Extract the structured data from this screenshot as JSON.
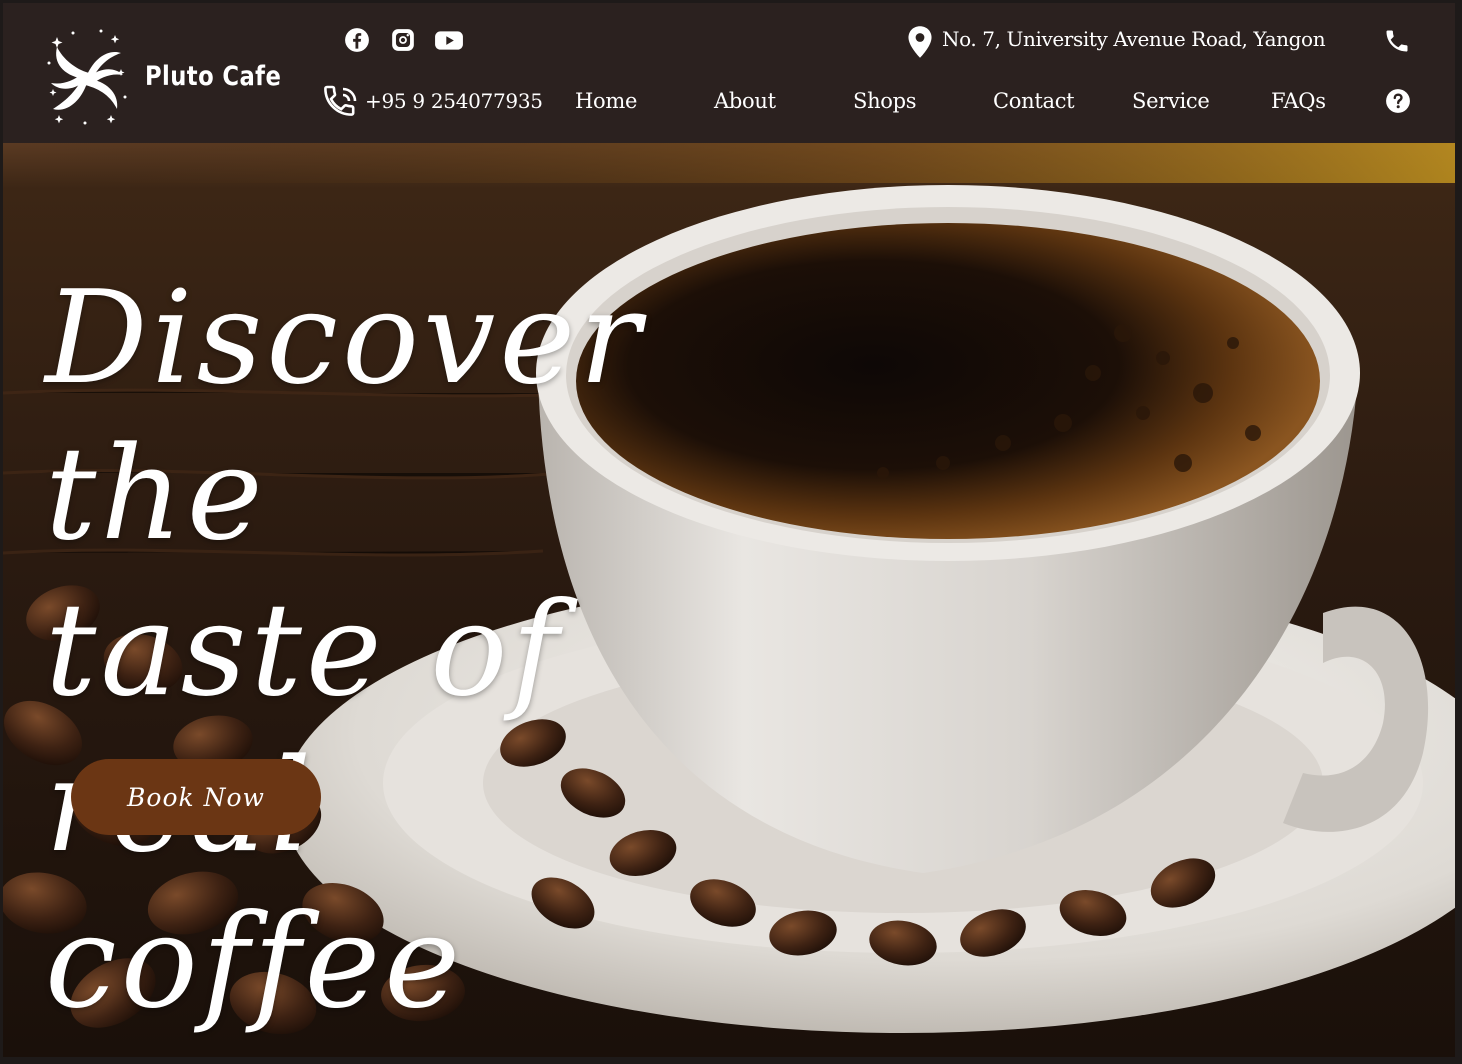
{
  "brand": {
    "name": "Pluto Cafe"
  },
  "header": {
    "social": [
      {
        "icon": "facebook-icon"
      },
      {
        "icon": "instagram-icon"
      },
      {
        "icon": "youtube-icon"
      }
    ],
    "address": "No. 7, University Avenue Road, Yangon",
    "phone": "+95 9 254077935"
  },
  "nav": {
    "items": [
      {
        "label": "Home"
      },
      {
        "label": "About"
      },
      {
        "label": "Shops"
      },
      {
        "label": "Contact"
      },
      {
        "label": "Service"
      },
      {
        "label": "FAQs"
      }
    ]
  },
  "hero": {
    "title_line1": "Discover the",
    "title_line2": "taste of real",
    "title_line3": "coffee",
    "cta_label": "Book Now"
  },
  "colors": {
    "header_bg": "#2b211f",
    "cta_bg": "#6b3614",
    "text": "#ffffff"
  }
}
